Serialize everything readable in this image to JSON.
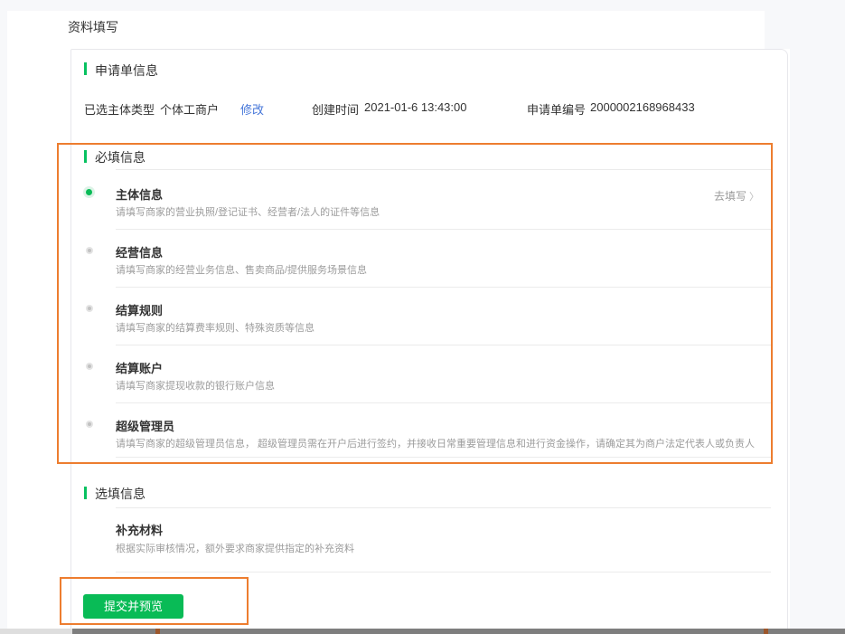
{
  "page": {
    "title": "资料填写"
  },
  "application_info": {
    "section_title": "申请单信息",
    "fields": [
      {
        "label": "已选主体类型",
        "value": "个体工商户",
        "action": "修改"
      },
      {
        "label": "创建时间",
        "value": "2021-01-6 13:43:00"
      },
      {
        "label": "申请单编号",
        "value": "2000002168968433"
      }
    ]
  },
  "required_info": {
    "section_title": "必填信息",
    "items": [
      {
        "title": "主体信息",
        "desc": "请填写商家的营业执照/登记证书、经营者/法人的证件等信息",
        "status": "selected",
        "action_label": "去填写",
        "action_chevron": "〉"
      },
      {
        "title": "经营信息",
        "desc": "请填写商家的经营业务信息、售卖商品/提供服务场景信息",
        "status": "pending"
      },
      {
        "title": "结算规则",
        "desc": "请填写商家的结算费率规则、特殊资质等信息",
        "status": "pending"
      },
      {
        "title": "结算账户",
        "desc": "请填写商家提现收款的银行账户信息",
        "status": "pending"
      },
      {
        "title": "超级管理员",
        "desc": "请填写商家的超级管理员信息， 超级管理员需在开户后进行签约，并接收日常重要管理信息和进行资金操作，请确定其为商户法定代表人或负责人",
        "status": "pending"
      }
    ]
  },
  "optional_info": {
    "section_title": "选填信息",
    "items": [
      {
        "title": "补充材料",
        "desc": "根据实际审核情况，额外要求商家提供指定的补充资料"
      }
    ]
  },
  "actions": {
    "submit_label": "提交并预览"
  },
  "colors": {
    "accent_green": "#07C160",
    "button_green": "#09BB56",
    "highlight_orange": "#ED7D2F",
    "link_blue": "#4576D9",
    "desc_gray": "#9C9C9C"
  }
}
